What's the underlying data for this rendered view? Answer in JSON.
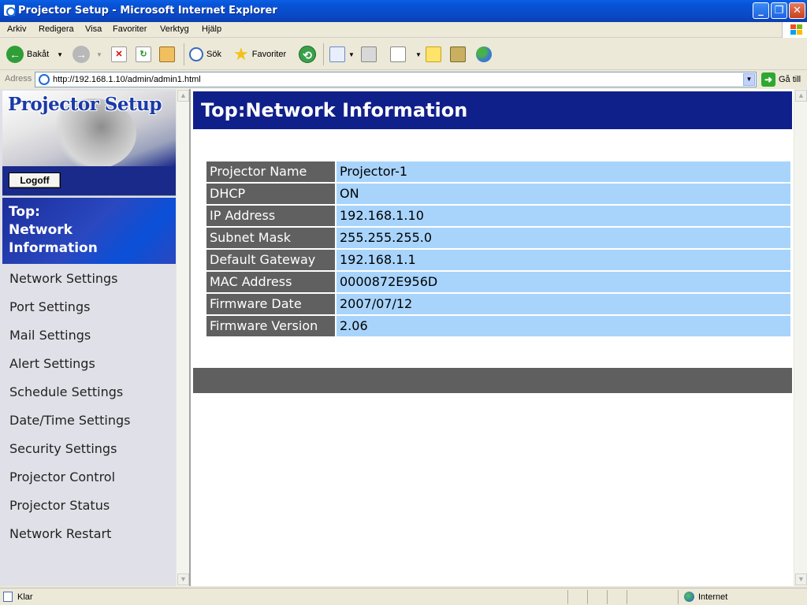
{
  "window": {
    "title": "Projector Setup - Microsoft Internet Explorer",
    "buttons": {
      "minimize": "_",
      "maximize": "❐",
      "close": "✕"
    }
  },
  "menu": [
    "Arkiv",
    "Redigera",
    "Visa",
    "Favoriter",
    "Verktyg",
    "Hjälp"
  ],
  "toolbar": {
    "back_label": "Bakåt",
    "search_label": "Sök",
    "favorites_label": "Favoriter"
  },
  "address": {
    "label": "Adress",
    "url": "http://192.168.1.10/admin/admin1.html",
    "go_label": "Gå till"
  },
  "sidebar": {
    "logo_title": "Projector Setup",
    "logoff_label": "Logoff",
    "active_item": [
      "Top:",
      "Network",
      "Information"
    ],
    "items": [
      "Network Settings",
      "Port Settings",
      "Mail Settings",
      "Alert Settings",
      "Schedule Settings",
      "Date/Time Settings",
      "Security Settings",
      "Projector Control",
      "Projector Status",
      "Network Restart"
    ]
  },
  "main": {
    "header": "Top:Network Information",
    "rows": [
      {
        "label": "Projector Name",
        "value": "Projector-1"
      },
      {
        "label": "DHCP",
        "value": "ON"
      },
      {
        "label": "IP Address",
        "value": "192.168.1.10"
      },
      {
        "label": "Subnet Mask",
        "value": "255.255.255.0"
      },
      {
        "label": "Default Gateway",
        "value": "192.168.1.1"
      },
      {
        "label": "MAC Address",
        "value": "0000872E956D"
      },
      {
        "label": "Firmware Date",
        "value": "2007/07/12"
      },
      {
        "label": "Firmware Version",
        "value": "2.06"
      }
    ]
  },
  "status": {
    "text": "Klar",
    "zone": "Internet"
  },
  "colors": {
    "header_bg": "#10208a",
    "label_bg": "#606060",
    "value_bg": "#a8d4fc",
    "nav_active_bg": "#2a48c0"
  }
}
